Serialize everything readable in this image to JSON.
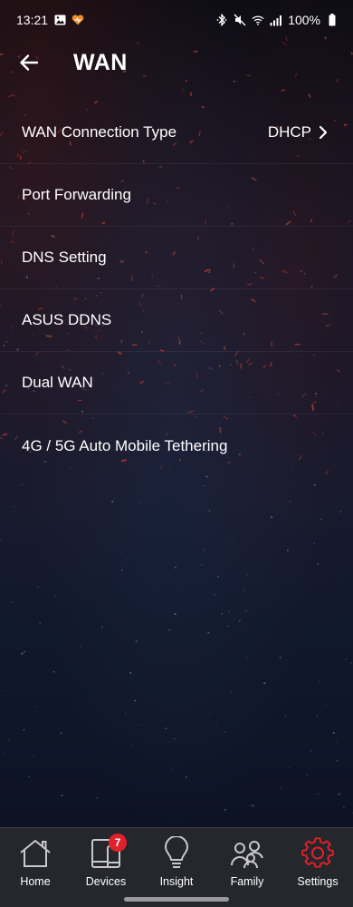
{
  "status_bar": {
    "time": "13:21",
    "battery_percent": "100%",
    "left_icons": [
      "image-icon",
      "heart-icon"
    ],
    "right_icons": [
      "bluetooth-icon",
      "mute-icon",
      "wifi-icon",
      "signal-icon",
      "battery-icon"
    ]
  },
  "header": {
    "back_icon": "back-arrow-icon",
    "title": "WAN"
  },
  "settings": {
    "items": [
      {
        "label": "WAN Connection Type",
        "value": "DHCP",
        "has_chevron": true
      },
      {
        "label": "Port Forwarding"
      },
      {
        "label": "DNS Setting"
      },
      {
        "label": "ASUS DDNS"
      },
      {
        "label": "Dual WAN"
      },
      {
        "label": "4G / 5G Auto Mobile Tethering"
      }
    ]
  },
  "bottom_nav": {
    "items": [
      {
        "label": "Home",
        "icon": "home-icon",
        "active": false
      },
      {
        "label": "Devices",
        "icon": "devices-icon",
        "badge": "7",
        "active": false
      },
      {
        "label": "Insight",
        "icon": "lightbulb-icon",
        "active": false
      },
      {
        "label": "Family",
        "icon": "family-icon",
        "active": false
      },
      {
        "label": "Settings",
        "icon": "gear-icon",
        "active": true
      }
    ]
  },
  "colors": {
    "accent": "#e0202a",
    "nav_background": "#25272d",
    "background": "#111627"
  }
}
